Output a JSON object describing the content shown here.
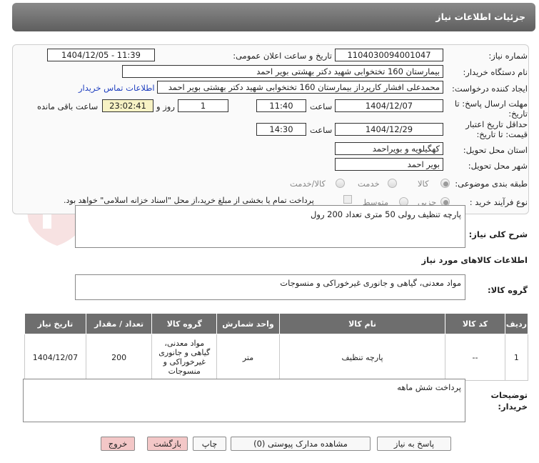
{
  "page": {
    "title": "جزئیات اطلاعات نیاز"
  },
  "form": {
    "need_number": {
      "label": "شماره نیاز:",
      "value": "1104030094001047"
    },
    "announce": {
      "label": "تاریخ و ساعت اعلان عمومی:",
      "value": "1404/12/05 - 11:39"
    },
    "buyer_org": {
      "label": "نام دستگاه خریدار:",
      "value": "بیمارستان 160 تختخوابی شهید دکتر بهشتی بویر احمد"
    },
    "requester": {
      "label": "ایجاد کننده درخواست:",
      "value": "محمدعلی افشار کارپرداز بیمارستان 160 تختخوابی شهید دکتر بهشتی بویر احمد",
      "contact_link": "اطلاعات تماس خریدار"
    },
    "deadline": {
      "label_line1": "مهلت ارسال پاسخ: تا",
      "label_line2": "تاریخ:",
      "date": "1404/12/07",
      "time_label": "ساعت",
      "time": "11:40",
      "days": "1",
      "days_label": "روز و",
      "remaining": "23:02:41",
      "remaining_label": "ساعت باقی مانده"
    },
    "validity": {
      "label_line1": "حداقل تاریخ اعتبار",
      "label_line2": "قیمت: تا تاریخ:",
      "date": "1404/12/29",
      "time_label": "ساعت",
      "time": "14:30"
    },
    "province": {
      "label": "استان محل تحویل:",
      "value": "کهگیلویه و بویراحمد"
    },
    "city": {
      "label": "شهر محل تحویل:",
      "value": "بویر احمد"
    },
    "category": {
      "label": "طبقه بندی موضوعی:",
      "options": [
        "کالا",
        "خدمت",
        "کالا/خدمت"
      ],
      "selected": "کالا"
    },
    "process": {
      "label": "نوع فرآیند خرید :",
      "options": [
        "جزیی",
        "متوسط"
      ],
      "selected": "جزیی",
      "note": "پرداخت تمام یا بخشی از مبلغ خرید،از محل \"اسناد خزانه اسلامی\" خواهد بود."
    }
  },
  "summary": {
    "label": "شرح کلی نیاز:",
    "value": "پارچه تنظیف رولی 50 متری تعداد 200 رول"
  },
  "goods_section": {
    "title": "اطلاعات کالاهای مورد نیاز"
  },
  "goods_group": {
    "label": "گروه کالا:",
    "value": "مواد معدنی، گیاهی و جانوری غیرخوراکی و منسوجات"
  },
  "table": {
    "headers": [
      "ردیف",
      "کد کالا",
      "نام کالا",
      "واحد شمارش",
      "گروه کالا",
      "تعداد / مقدار",
      "تاریخ نیاز"
    ],
    "rows": [
      [
        "1",
        "--",
        "پارچه تنظیف",
        "متر",
        "مواد معدنی، گیاهی و جانوری غیرخوراکی و منسوجات",
        "200",
        "1404/12/07"
      ]
    ]
  },
  "buyer_notes": {
    "label_line1": "توضیحات",
    "label_line2": "خریدار:",
    "value": "پرداخت شش ماهه"
  },
  "buttons": {
    "reply": "پاسخ به نیاز",
    "docs": "مشاهده مدارک پیوستی (0)",
    "print": "چاپ",
    "back": "بازگشت",
    "exit": "خروج"
  }
}
